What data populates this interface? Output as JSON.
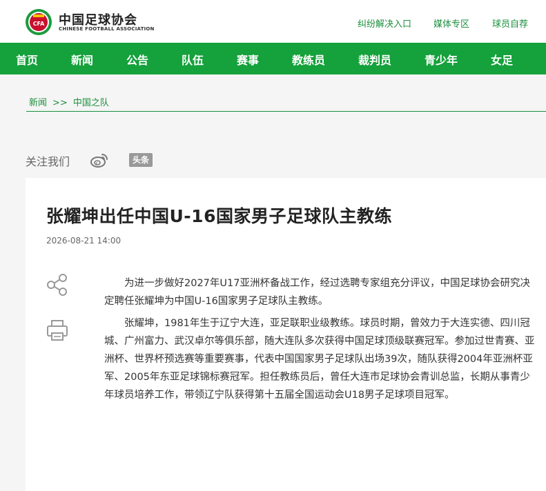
{
  "header": {
    "brand_cn": "中国足球协会",
    "brand_en": "CHINESE FOOTBALL ASSOCIATION",
    "logo_text": "CFA",
    "links": [
      "纠纷解决入口",
      "媒体专区",
      "球员自荐"
    ]
  },
  "nav": {
    "items": [
      "首页",
      "新闻",
      "公告",
      "队伍",
      "赛事",
      "教练员",
      "裁判员",
      "青少年",
      "女足"
    ]
  },
  "breadcrumb": {
    "items": [
      "新闻",
      "中国之队"
    ],
    "separator": ">>"
  },
  "follow": {
    "label": "关注我们",
    "toutiao_label": "头条"
  },
  "article": {
    "title": "张耀坤出任中国U-16国家男子足球队主教练",
    "date": "2026-08-21 14:00",
    "paragraphs": [
      "为进一步做好2027年U17亚洲杯备战工作，经过选聘专家组充分评议，中国足球协会研究决定聘任张耀坤为中国U-16国家男子足球队主教练。",
      "张耀坤，1981年生于辽宁大连，亚足联职业级教练。球员时期，曾效力于大连实德、四川冠城、广州富力、武汉卓尔等俱乐部，随大连队多次获得中国足球顶级联赛冠军。参加过世青赛、亚洲杯、世界杯预选赛等重要赛事，代表中国国家男子足球队出场39次，随队获得2004年亚洲杯亚军、2005年东亚足球锦标赛冠军。担任教练员后，曾任大连市足球协会青训总监，长期从事青少年球员培养工作，带领辽宁队获得第十五届全国运动会U18男子足球项目冠军。"
    ]
  },
  "colors": {
    "brand_green": "#15a13b",
    "link_green": "#1a8f3c"
  }
}
